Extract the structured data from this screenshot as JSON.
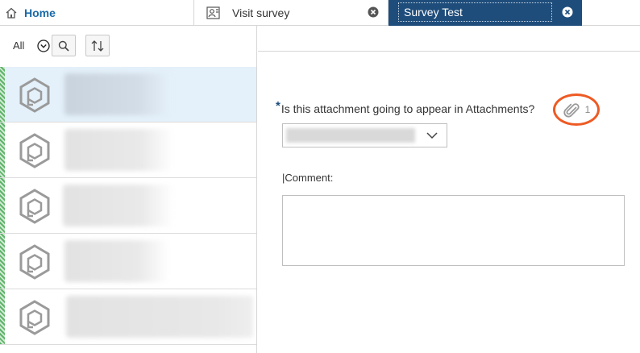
{
  "tabs": {
    "home": {
      "label": "Home",
      "icon": "home-icon"
    },
    "visit": {
      "label": "Visit survey",
      "icon": "visit-survey-icon",
      "close_icon": "close-icon"
    },
    "active": {
      "label": "Survey Test",
      "close_icon": "close-icon",
      "color": "#1e4d7b"
    }
  },
  "filterbar": {
    "filter_label": "All",
    "filter_icon": "chevron-down-circle-icon",
    "search_icon": "search-icon",
    "sort_icon": "sort-icon"
  },
  "list": {
    "item_icon": "package-hex-icon",
    "stripe_color": "#5fb36a",
    "items": [
      {
        "selected": true
      },
      {
        "selected": false
      },
      {
        "selected": false
      },
      {
        "selected": false
      },
      {
        "selected": false
      }
    ]
  },
  "form": {
    "required_marker": "*",
    "question": "Is this attachment going to appear in Attachments?",
    "attachment_icon": "paperclip-icon",
    "attachment_count": "1",
    "highlight_color": "#ee5a24",
    "comment_label": "|Comment:",
    "comment_value": ""
  }
}
